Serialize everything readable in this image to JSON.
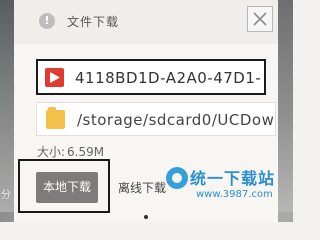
{
  "background": {
    "left_text": "分"
  },
  "dialog": {
    "title": "文件下载",
    "icons": {
      "info": "info-circle-icon",
      "close": "close-icon"
    },
    "file_name": "4118BD1D-A2A0-47D1-",
    "save_path": "/storage/sdcard0/UCDow",
    "size_label": "大小:",
    "size_value": "6.59M",
    "local_download_label": "本地下载",
    "offline_download_label": "离线下载"
  },
  "watermark": {
    "text": "统一下载站",
    "url": "www.3987.com"
  },
  "colors": {
    "video_icon": "#e03b2f",
    "folder_icon": "#f5c04a",
    "primary_button": "#7e7c7a",
    "watermark": "#2a8fd0"
  }
}
